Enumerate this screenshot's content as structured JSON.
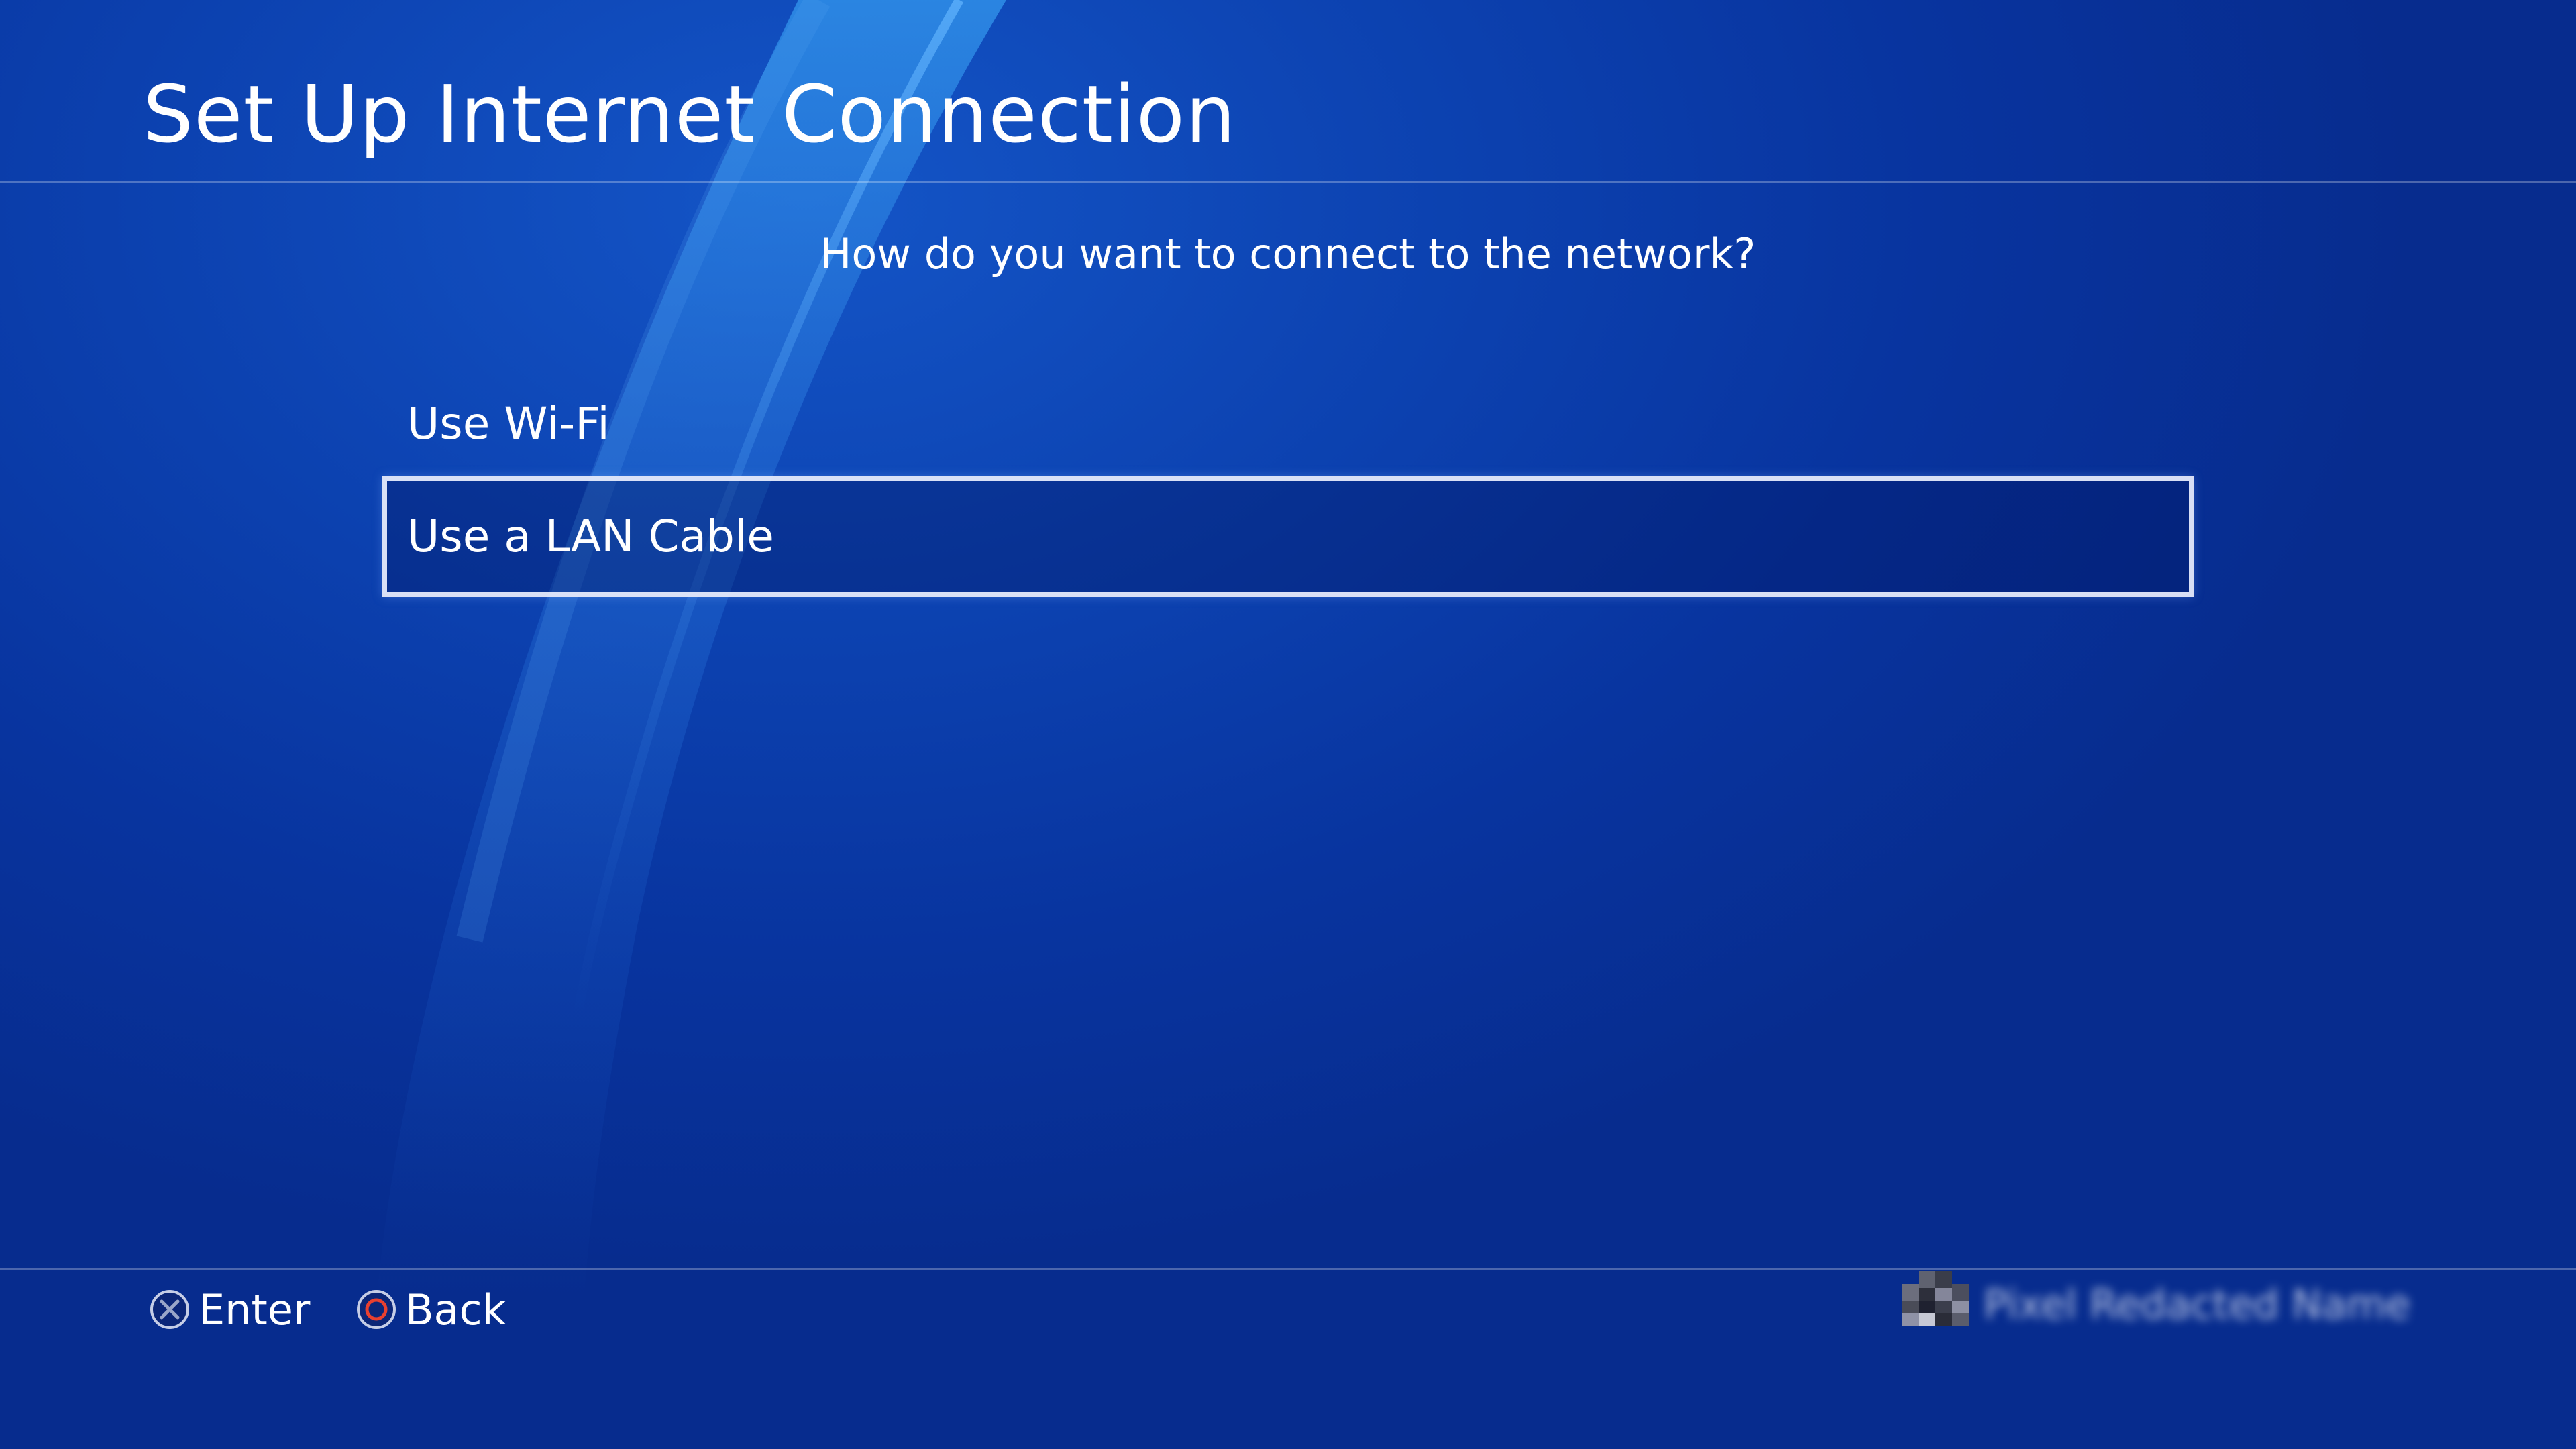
{
  "screen": {
    "title": "Set Up Internet Connection",
    "question": "How do you want to connect to the network?"
  },
  "menu": {
    "selected_index": 1,
    "items": [
      {
        "label": "Use Wi-Fi"
      },
      {
        "label": "Use a LAN Cable"
      }
    ]
  },
  "footer": {
    "enter_label": "Enter",
    "back_label": "Back",
    "enter_icon": "cross-button-icon",
    "back_icon": "circle-button-icon"
  },
  "user": {
    "avatar_icon": "user-avatar",
    "name": "Pixel Redacted Name"
  },
  "colors": {
    "background": "#0a3aa8",
    "text": "#ffffff",
    "cross_icon": "#9aa6c8",
    "circle_icon": "#e8402f"
  }
}
